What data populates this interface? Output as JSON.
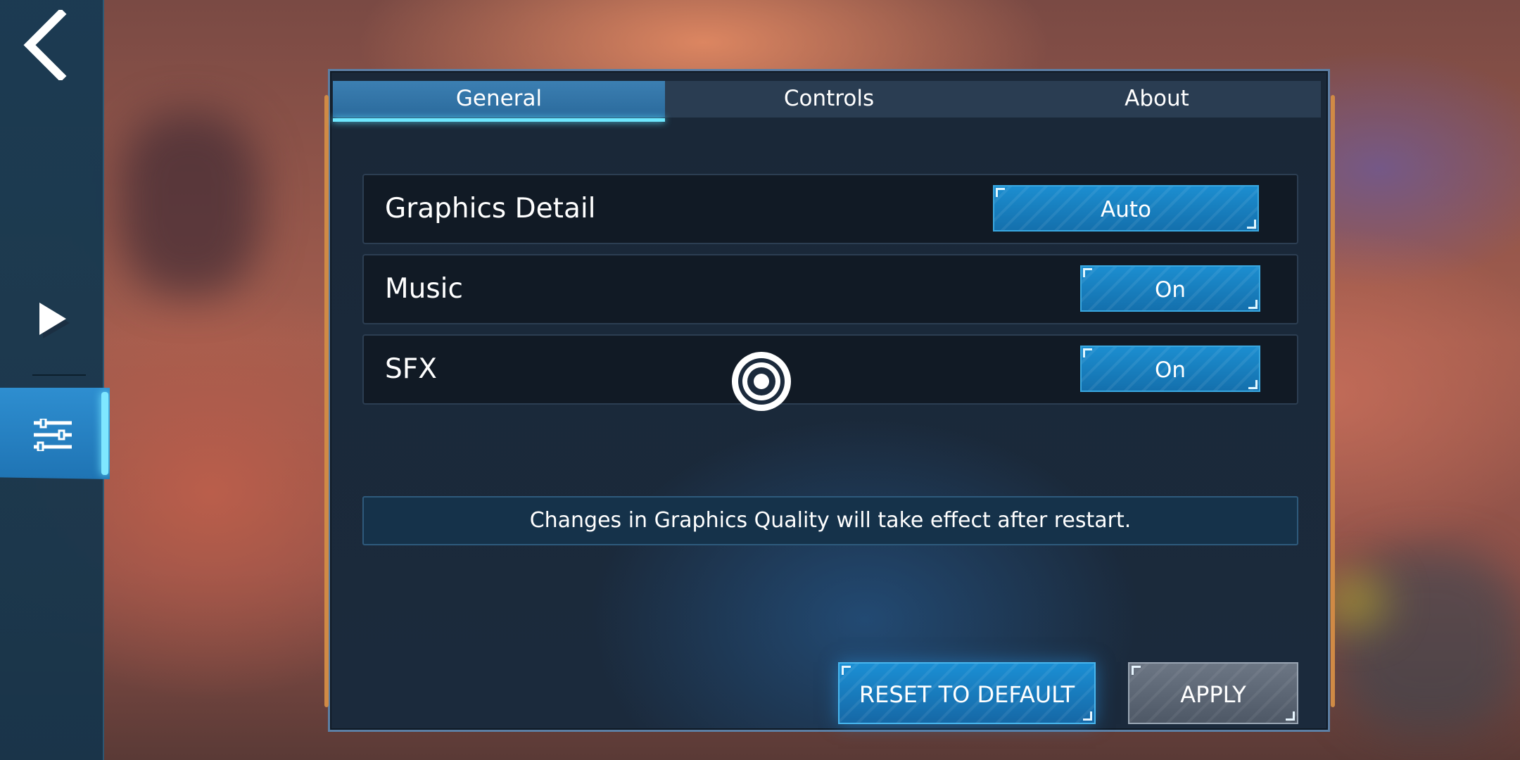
{
  "tabs": [
    {
      "label": "General",
      "active": true
    },
    {
      "label": "Controls",
      "active": false
    },
    {
      "label": "About",
      "active": false
    }
  ],
  "settings": [
    {
      "label": "Graphics Detail",
      "value": "Auto"
    },
    {
      "label": "Music",
      "value": "On"
    },
    {
      "label": "SFX",
      "value": "On"
    }
  ],
  "notice": "Changes in Graphics Quality will take effect after restart.",
  "buttons": {
    "reset": "RESET TO DEFAULT",
    "apply": "APPLY"
  },
  "sidebar": {
    "items": [
      {
        "icon": "back-arrow-icon"
      },
      {
        "icon": "play-icon"
      },
      {
        "icon": "settings-sliders-icon",
        "active": true
      }
    ]
  },
  "colors": {
    "accent": "#1c8ed0",
    "active_tab_underline": "#6ee8ff",
    "panel_bg": "#1a2838",
    "panel_side_accent": "#d08a45"
  }
}
